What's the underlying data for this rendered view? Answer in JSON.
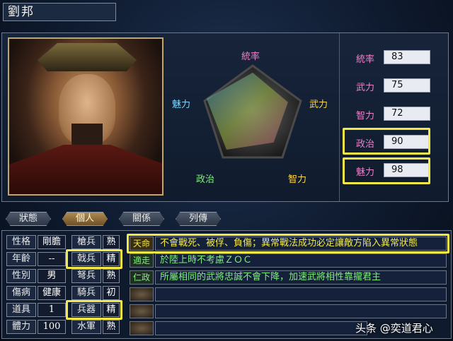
{
  "title": "劉邦",
  "radar": {
    "labels": [
      "統率",
      "武力",
      "智力",
      "政治",
      "魅力"
    ],
    "colors": {
      "top": "#e884c8",
      "right": "#ffd84a",
      "bottom_right": "#ffd84a",
      "bottom_left": "#7ff07a",
      "left": "#7fd8ff"
    }
  },
  "stats": [
    {
      "label": "統率",
      "value": "83"
    },
    {
      "label": "武力",
      "value": "75"
    },
    {
      "label": "智力",
      "value": "72"
    },
    {
      "label": "政治",
      "value": "90"
    },
    {
      "label": "魅力",
      "value": "98"
    }
  ],
  "stat_values_numeric": [
    83,
    75,
    72,
    90,
    98
  ],
  "tabs": [
    {
      "label": "狀態",
      "active": false
    },
    {
      "label": "個人",
      "active": true
    },
    {
      "label": "關係",
      "active": false
    },
    {
      "label": "列傳",
      "active": false
    }
  ],
  "attributes": [
    {
      "label": "性格",
      "value": "剛膽"
    },
    {
      "label": "年齡",
      "value": "--"
    },
    {
      "label": "性別",
      "value": "男"
    },
    {
      "label": "傷病",
      "value": "健康"
    },
    {
      "label": "道具",
      "value": "1"
    },
    {
      "label": "體力",
      "value": "100"
    }
  ],
  "aptitudes": [
    {
      "label": "槍兵",
      "value": "熟"
    },
    {
      "label": "戟兵",
      "value": "精"
    },
    {
      "label": "弩兵",
      "value": "熟"
    },
    {
      "label": "騎兵",
      "value": "初"
    },
    {
      "label": "兵器",
      "value": "精"
    },
    {
      "label": "水軍",
      "value": "熟"
    }
  ],
  "skills": [
    {
      "name": "天命",
      "desc": "不會戰死、被俘、負傷；異常戰法成功必定讓敵方陷入異常狀態",
      "name_color": "#f2e84a"
    },
    {
      "name": "適走",
      "desc": "於陸上時不考慮ＺＯＣ",
      "name_color": "#7ff07a"
    },
    {
      "name": "仁政",
      "desc": "所屬相同的武將忠誠不會下降，加速武將相性靠攏君主",
      "name_color": "#7ff07a"
    },
    {
      "name": "",
      "desc": ""
    },
    {
      "name": "",
      "desc": ""
    },
    {
      "name": "",
      "desc": ""
    }
  ],
  "watermark": "头条 @奕道君心"
}
